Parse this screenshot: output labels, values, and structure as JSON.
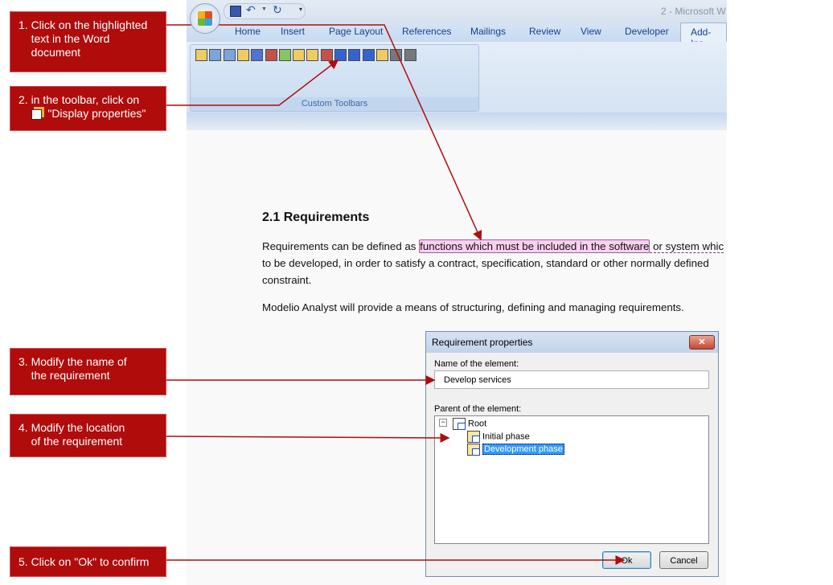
{
  "callouts": [
    {
      "text": "1. Click on the highlighted\n    text in the Word\n    document"
    },
    {
      "text_before": "2. in the toolbar, click on",
      "text_after": "\"Display properties\"",
      "icon": "display-properties-icon"
    },
    {
      "text": "3. Modify the name of\n    the requirement"
    },
    {
      "text": "4. Modify the location\n    of the requirement"
    },
    {
      "text": "5. Click on \"Ok\" to confirm"
    }
  ],
  "word": {
    "title": "2 - Microsoft W",
    "tabs": [
      "Home",
      "Insert",
      "Page Layout",
      "References",
      "Mailings",
      "Review",
      "View",
      "Developer",
      "Add-Ins"
    ],
    "active_tab": "Add-Ins",
    "group_label": "Custom Toolbars",
    "document": {
      "heading": "2.1 Requirements",
      "p1_before": "Requirements can be defined as ",
      "p1_highlight": "functions which must be included in the software",
      "p1_after": " or system whic",
      "p1_line2": "to be developed, in order to satisfy a contract, specification, standard or other normally defined",
      "p1_line3": "constraint.",
      "p2": "Modelio Analyst will provide a means of structuring, defining and managing requirements."
    }
  },
  "dialog": {
    "title": "Requirement properties",
    "close_label": "✕",
    "name_label": "Name of the element:",
    "name_value": "Develop services",
    "parent_label": "Parent of the element:",
    "tree": {
      "root": "Root",
      "children": [
        "Initial phase",
        "Development phase"
      ],
      "selected": "Development phase"
    },
    "ok_label": "Ok",
    "cancel_label": "Cancel"
  },
  "colors": {
    "callout": "#b00c0c",
    "arrow": "#b00c0c",
    "highlight": "#f8d0f2",
    "selection": "#3399ff"
  }
}
